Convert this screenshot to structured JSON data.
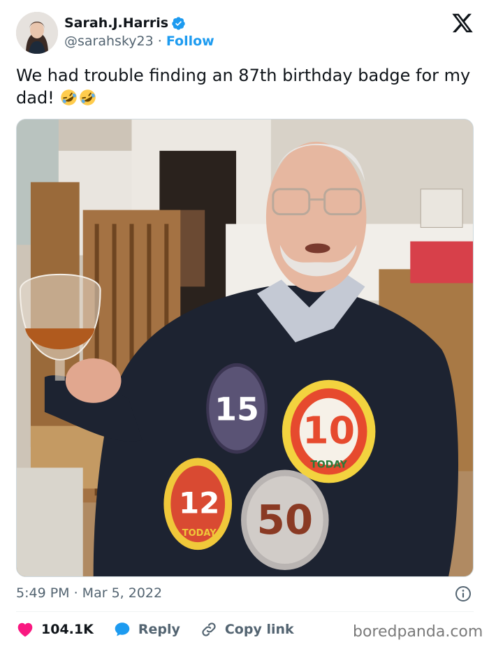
{
  "author": {
    "display_name": "Sarah.J.Harris",
    "handle": "@sarahsky23",
    "separator": "·",
    "follow_label": "Follow"
  },
  "tweet": {
    "text": "We had trouble finding an 87th birthday badge for my dad!",
    "emoji": [
      "rolling-on-floor-laughing-emoji",
      "rolling-on-floor-laughing-emoji"
    ]
  },
  "photo": {
    "badges": [
      "15",
      "10",
      "12",
      "50"
    ],
    "badge_caption": "TODAY"
  },
  "meta": {
    "timestamp": "5:49 PM · Mar 5, 2022"
  },
  "actions": {
    "likes": "104.1K",
    "reply_label": "Reply",
    "copy_link_label": "Copy link"
  },
  "watermark": "boredpanda.com",
  "colors": {
    "accent": "#1d9bf0",
    "like": "#f91880",
    "text": "#0f1419",
    "secondary": "#536471"
  }
}
